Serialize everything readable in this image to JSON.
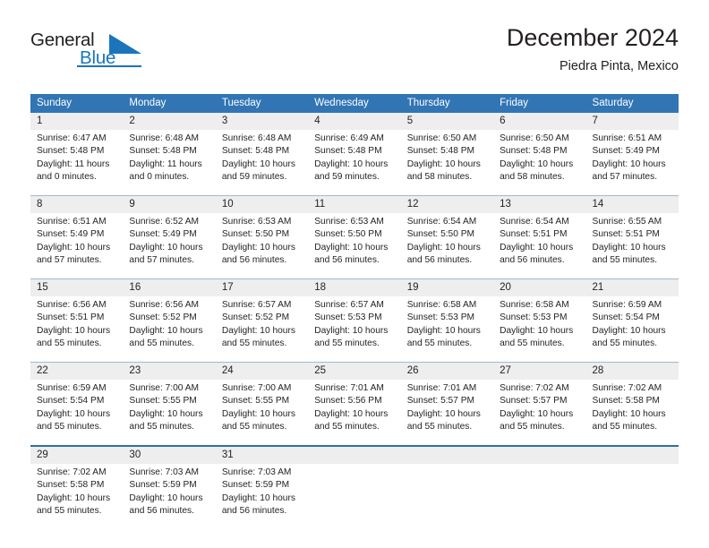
{
  "brand": {
    "name_part1": "General",
    "name_part2": "Blue",
    "accent_color": "#1b75bb"
  },
  "header": {
    "title": "December 2024",
    "subtitle": "Piedra Pinta, Mexico"
  },
  "theme": {
    "header_blue": "#3175b4",
    "daynum_band": "#eeeeee",
    "week_divider": "#9fb9d2",
    "last_week_border": "#2e6da4"
  },
  "weekday_headers": [
    "Sunday",
    "Monday",
    "Tuesday",
    "Wednesday",
    "Thursday",
    "Friday",
    "Saturday"
  ],
  "weeks": [
    {
      "days": [
        {
          "num": "1",
          "sunrise": "Sunrise: 6:47 AM",
          "sunset": "Sunset: 5:48 PM",
          "daylight1": "Daylight: 11 hours",
          "daylight2": "and 0 minutes."
        },
        {
          "num": "2",
          "sunrise": "Sunrise: 6:48 AM",
          "sunset": "Sunset: 5:48 PM",
          "daylight1": "Daylight: 11 hours",
          "daylight2": "and 0 minutes."
        },
        {
          "num": "3",
          "sunrise": "Sunrise: 6:48 AM",
          "sunset": "Sunset: 5:48 PM",
          "daylight1": "Daylight: 10 hours",
          "daylight2": "and 59 minutes."
        },
        {
          "num": "4",
          "sunrise": "Sunrise: 6:49 AM",
          "sunset": "Sunset: 5:48 PM",
          "daylight1": "Daylight: 10 hours",
          "daylight2": "and 59 minutes."
        },
        {
          "num": "5",
          "sunrise": "Sunrise: 6:50 AM",
          "sunset": "Sunset: 5:48 PM",
          "daylight1": "Daylight: 10 hours",
          "daylight2": "and 58 minutes."
        },
        {
          "num": "6",
          "sunrise": "Sunrise: 6:50 AM",
          "sunset": "Sunset: 5:48 PM",
          "daylight1": "Daylight: 10 hours",
          "daylight2": "and 58 minutes."
        },
        {
          "num": "7",
          "sunrise": "Sunrise: 6:51 AM",
          "sunset": "Sunset: 5:49 PM",
          "daylight1": "Daylight: 10 hours",
          "daylight2": "and 57 minutes."
        }
      ]
    },
    {
      "days": [
        {
          "num": "8",
          "sunrise": "Sunrise: 6:51 AM",
          "sunset": "Sunset: 5:49 PM",
          "daylight1": "Daylight: 10 hours",
          "daylight2": "and 57 minutes."
        },
        {
          "num": "9",
          "sunrise": "Sunrise: 6:52 AM",
          "sunset": "Sunset: 5:49 PM",
          "daylight1": "Daylight: 10 hours",
          "daylight2": "and 57 minutes."
        },
        {
          "num": "10",
          "sunrise": "Sunrise: 6:53 AM",
          "sunset": "Sunset: 5:50 PM",
          "daylight1": "Daylight: 10 hours",
          "daylight2": "and 56 minutes."
        },
        {
          "num": "11",
          "sunrise": "Sunrise: 6:53 AM",
          "sunset": "Sunset: 5:50 PM",
          "daylight1": "Daylight: 10 hours",
          "daylight2": "and 56 minutes."
        },
        {
          "num": "12",
          "sunrise": "Sunrise: 6:54 AM",
          "sunset": "Sunset: 5:50 PM",
          "daylight1": "Daylight: 10 hours",
          "daylight2": "and 56 minutes."
        },
        {
          "num": "13",
          "sunrise": "Sunrise: 6:54 AM",
          "sunset": "Sunset: 5:51 PM",
          "daylight1": "Daylight: 10 hours",
          "daylight2": "and 56 minutes."
        },
        {
          "num": "14",
          "sunrise": "Sunrise: 6:55 AM",
          "sunset": "Sunset: 5:51 PM",
          "daylight1": "Daylight: 10 hours",
          "daylight2": "and 55 minutes."
        }
      ]
    },
    {
      "days": [
        {
          "num": "15",
          "sunrise": "Sunrise: 6:56 AM",
          "sunset": "Sunset: 5:51 PM",
          "daylight1": "Daylight: 10 hours",
          "daylight2": "and 55 minutes."
        },
        {
          "num": "16",
          "sunrise": "Sunrise: 6:56 AM",
          "sunset": "Sunset: 5:52 PM",
          "daylight1": "Daylight: 10 hours",
          "daylight2": "and 55 minutes."
        },
        {
          "num": "17",
          "sunrise": "Sunrise: 6:57 AM",
          "sunset": "Sunset: 5:52 PM",
          "daylight1": "Daylight: 10 hours",
          "daylight2": "and 55 minutes."
        },
        {
          "num": "18",
          "sunrise": "Sunrise: 6:57 AM",
          "sunset": "Sunset: 5:53 PM",
          "daylight1": "Daylight: 10 hours",
          "daylight2": "and 55 minutes."
        },
        {
          "num": "19",
          "sunrise": "Sunrise: 6:58 AM",
          "sunset": "Sunset: 5:53 PM",
          "daylight1": "Daylight: 10 hours",
          "daylight2": "and 55 minutes."
        },
        {
          "num": "20",
          "sunrise": "Sunrise: 6:58 AM",
          "sunset": "Sunset: 5:53 PM",
          "daylight1": "Daylight: 10 hours",
          "daylight2": "and 55 minutes."
        },
        {
          "num": "21",
          "sunrise": "Sunrise: 6:59 AM",
          "sunset": "Sunset: 5:54 PM",
          "daylight1": "Daylight: 10 hours",
          "daylight2": "and 55 minutes."
        }
      ]
    },
    {
      "days": [
        {
          "num": "22",
          "sunrise": "Sunrise: 6:59 AM",
          "sunset": "Sunset: 5:54 PM",
          "daylight1": "Daylight: 10 hours",
          "daylight2": "and 55 minutes."
        },
        {
          "num": "23",
          "sunrise": "Sunrise: 7:00 AM",
          "sunset": "Sunset: 5:55 PM",
          "daylight1": "Daylight: 10 hours",
          "daylight2": "and 55 minutes."
        },
        {
          "num": "24",
          "sunrise": "Sunrise: 7:00 AM",
          "sunset": "Sunset: 5:55 PM",
          "daylight1": "Daylight: 10 hours",
          "daylight2": "and 55 minutes."
        },
        {
          "num": "25",
          "sunrise": "Sunrise: 7:01 AM",
          "sunset": "Sunset: 5:56 PM",
          "daylight1": "Daylight: 10 hours",
          "daylight2": "and 55 minutes."
        },
        {
          "num": "26",
          "sunrise": "Sunrise: 7:01 AM",
          "sunset": "Sunset: 5:57 PM",
          "daylight1": "Daylight: 10 hours",
          "daylight2": "and 55 minutes."
        },
        {
          "num": "27",
          "sunrise": "Sunrise: 7:02 AM",
          "sunset": "Sunset: 5:57 PM",
          "daylight1": "Daylight: 10 hours",
          "daylight2": "and 55 minutes."
        },
        {
          "num": "28",
          "sunrise": "Sunrise: 7:02 AM",
          "sunset": "Sunset: 5:58 PM",
          "daylight1": "Daylight: 10 hours",
          "daylight2": "and 55 minutes."
        }
      ]
    },
    {
      "days": [
        {
          "num": "29",
          "sunrise": "Sunrise: 7:02 AM",
          "sunset": "Sunset: 5:58 PM",
          "daylight1": "Daylight: 10 hours",
          "daylight2": "and 55 minutes."
        },
        {
          "num": "30",
          "sunrise": "Sunrise: 7:03 AM",
          "sunset": "Sunset: 5:59 PM",
          "daylight1": "Daylight: 10 hours",
          "daylight2": "and 56 minutes."
        },
        {
          "num": "31",
          "sunrise": "Sunrise: 7:03 AM",
          "sunset": "Sunset: 5:59 PM",
          "daylight1": "Daylight: 10 hours",
          "daylight2": "and 56 minutes."
        },
        {
          "num": "",
          "sunrise": "",
          "sunset": "",
          "daylight1": "",
          "daylight2": ""
        },
        {
          "num": "",
          "sunrise": "",
          "sunset": "",
          "daylight1": "",
          "daylight2": ""
        },
        {
          "num": "",
          "sunrise": "",
          "sunset": "",
          "daylight1": "",
          "daylight2": ""
        },
        {
          "num": "",
          "sunrise": "",
          "sunset": "",
          "daylight1": "",
          "daylight2": ""
        }
      ]
    }
  ]
}
